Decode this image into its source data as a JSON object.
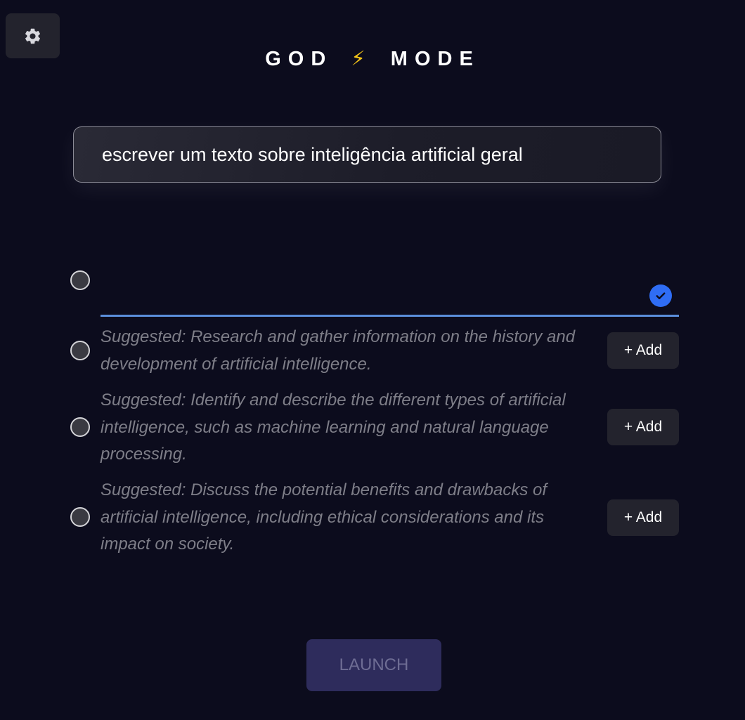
{
  "header": {
    "title_left": "GOD",
    "title_icon": "⚡",
    "title_right": "MODE",
    "settings_icon": "gear-icon"
  },
  "objective": {
    "value": "escrever um texto sobre inteligência artificial geral"
  },
  "task_input": {
    "value": "",
    "confirm_icon": "check-icon"
  },
  "suggestions": [
    {
      "text": "Suggested: Research and gather information on the history and development of artificial intelligence.",
      "add_label": "+ Add"
    },
    {
      "text": "Suggested: Identify and describe the different types of artificial intelligence, such as machine learning and natural language processing.",
      "add_label": "+ Add"
    },
    {
      "text": "Suggested: Discuss the potential benefits and drawbacks of artificial intelligence, including ethical considerations and its impact on society.",
      "add_label": "+ Add"
    }
  ],
  "launch": {
    "label": "LAUNCH"
  },
  "colors": {
    "background": "#0c0c1d",
    "accent_blue": "#2f6df5",
    "input_underline": "#5b8fdb",
    "launch_button": "#2e2c5c",
    "bolt": "#f5c518"
  }
}
